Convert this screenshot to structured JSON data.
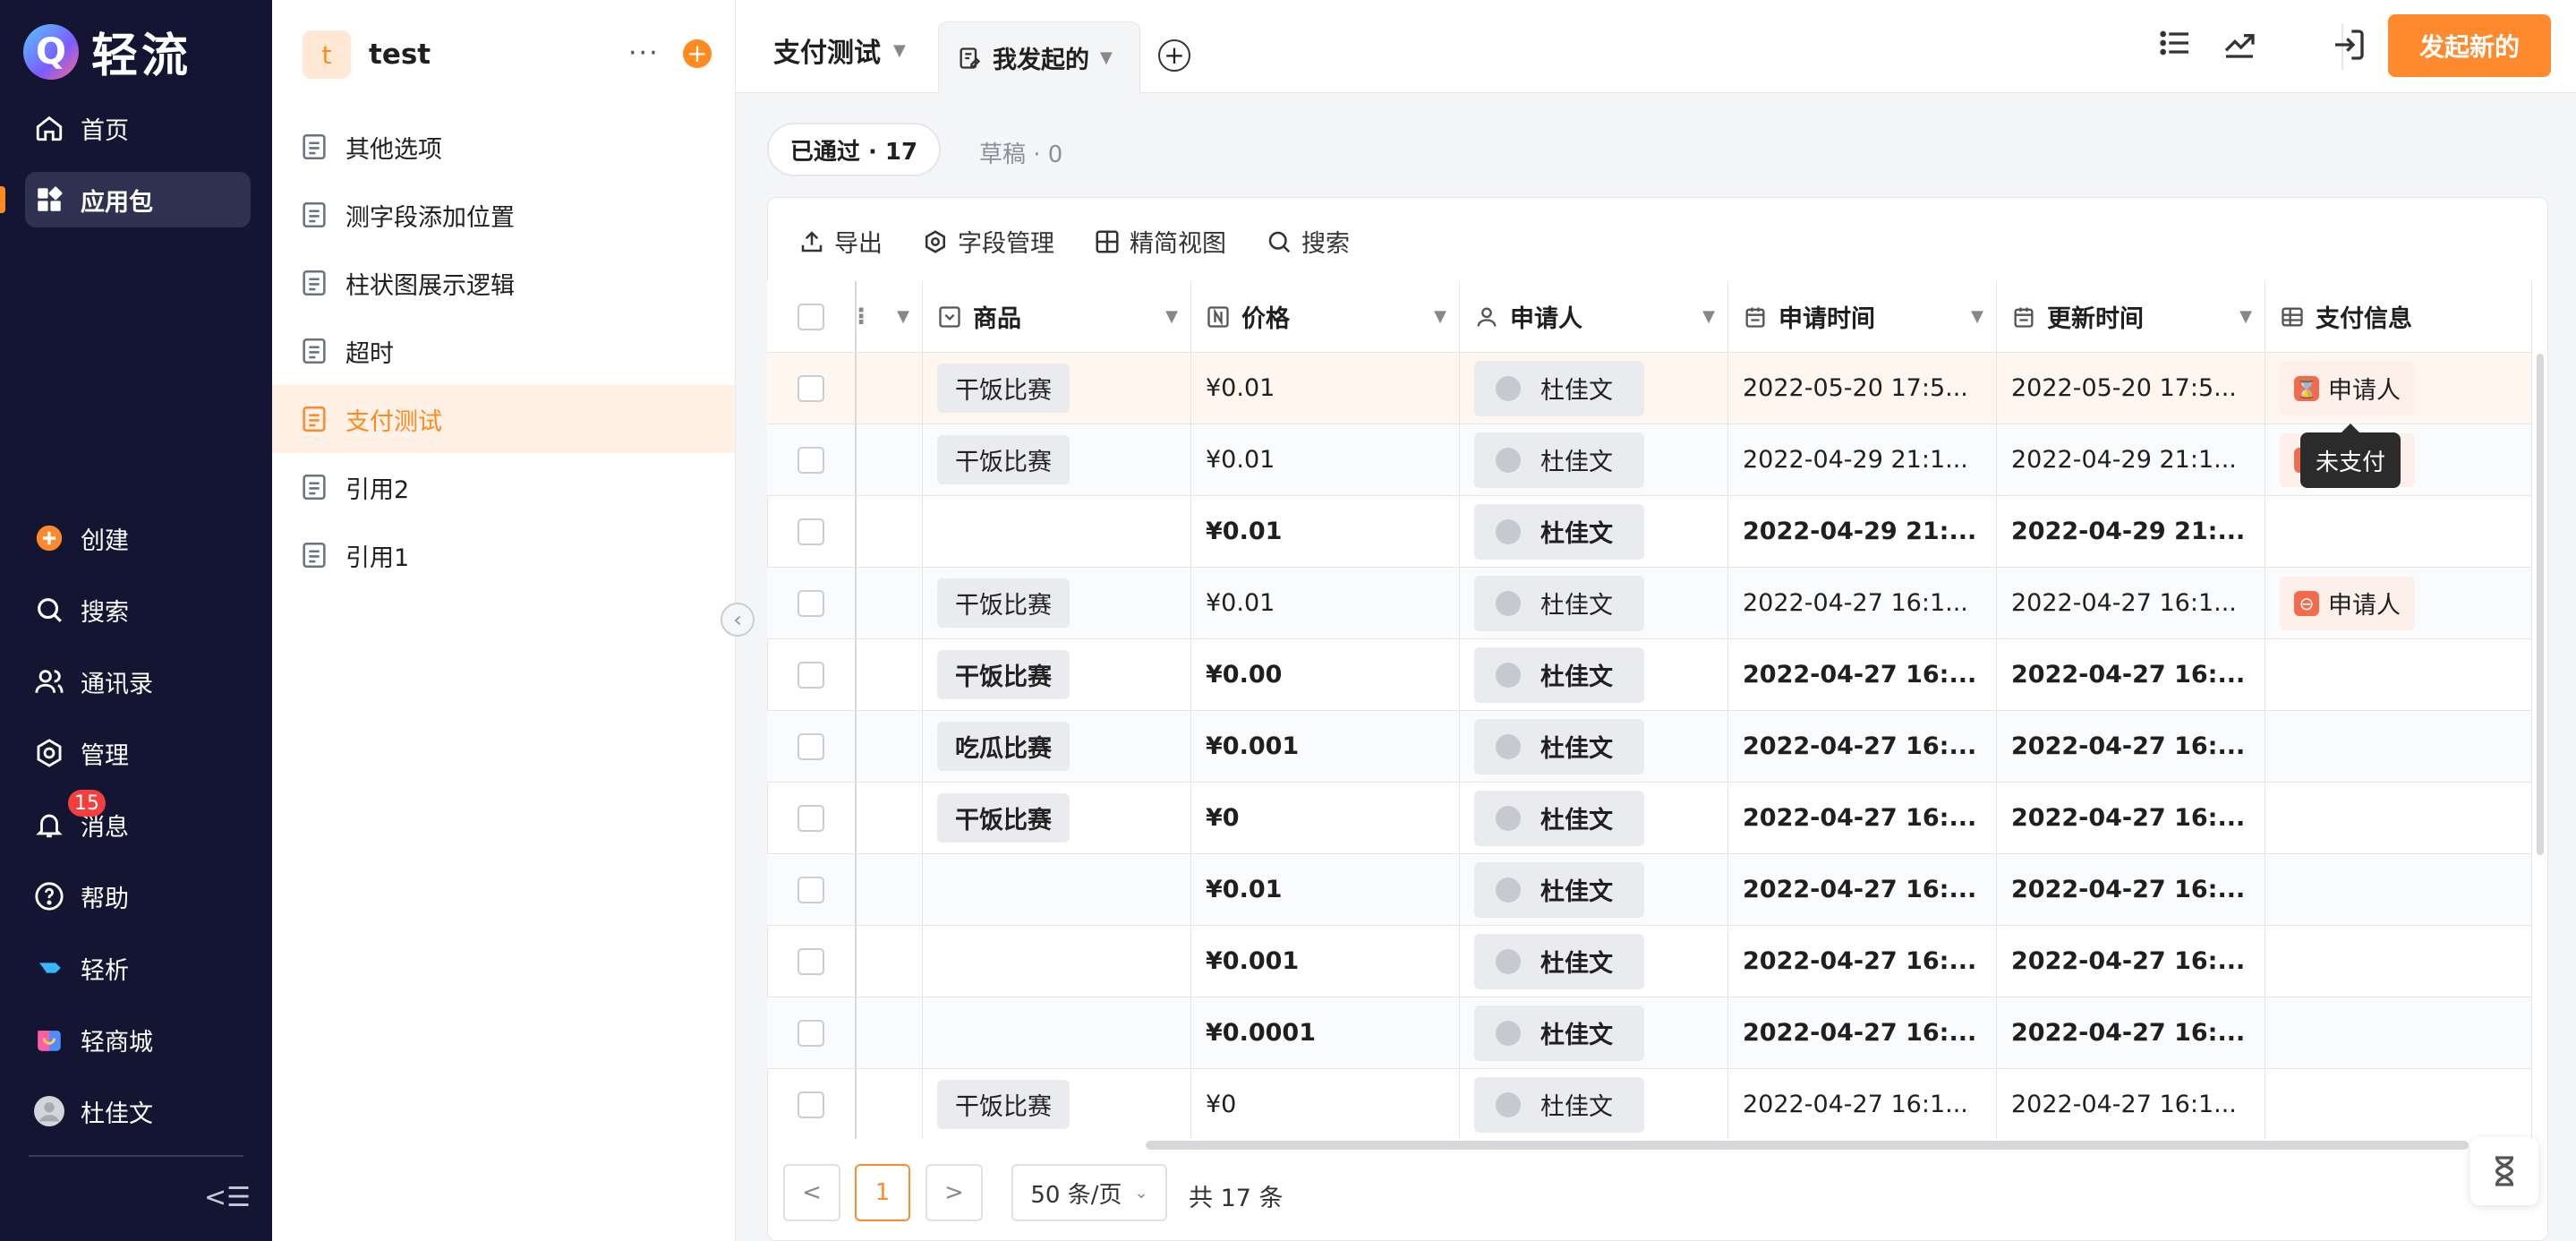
{
  "brand": {
    "mark": "Q",
    "name": "轻流"
  },
  "nav": {
    "top_items": [
      {
        "icon": "home-icon",
        "label": "首页"
      },
      {
        "icon": "apps-icon",
        "label": "应用包"
      }
    ],
    "bottom_items": [
      {
        "icon": "create-icon",
        "label": "创建"
      },
      {
        "icon": "search-icon",
        "label": "搜索"
      },
      {
        "icon": "contacts-icon",
        "label": "通讯录"
      },
      {
        "icon": "settings-icon",
        "label": "管理"
      },
      {
        "icon": "bell-icon",
        "label": "消息"
      },
      {
        "icon": "help-icon",
        "label": "帮助"
      },
      {
        "icon": "qingxi-icon",
        "label": "轻析"
      },
      {
        "icon": "shop-icon",
        "label": "轻商城"
      },
      {
        "icon": "avatar",
        "label": "杜佳文"
      }
    ],
    "message_badge": "15",
    "collapse_glyph": "<☰"
  },
  "sidebar": {
    "app_initial": "t",
    "app_name": "test",
    "more_glyph": "···",
    "add_glyph": "+",
    "forms": [
      "其他选项",
      "测字段添加位置",
      "柱状图展示逻辑",
      "超时",
      "支付测试",
      "引用2",
      "引用1"
    ],
    "active_form": "支付测试"
  },
  "topbar": {
    "form_title": "支付测试",
    "view_tab": "我发起的",
    "new_button": "发起新的"
  },
  "filters": {
    "approved": "已通过 · 17",
    "draft": "草稿 · 0"
  },
  "toolbar": {
    "export": "导出",
    "fields": "字段管理",
    "compact": "精简视图",
    "search": "搜索"
  },
  "table": {
    "columns": [
      "商品",
      "价格",
      "申请人",
      "申请时间",
      "更新时间",
      "支付信息"
    ],
    "rows": [
      {
        "product": "干饭比赛",
        "price": "¥0.01",
        "applicant": "杜佳文",
        "apply_time": "2022-05-20 17:5...",
        "update_time": "2022-05-20 17:5...",
        "pay": "申请人",
        "bold": false
      },
      {
        "product": "干饭比赛",
        "price": "¥0.01",
        "applicant": "杜佳文",
        "apply_time": "2022-04-29 21:1...",
        "update_time": "2022-04-29 21:1...",
        "pay": "申请人",
        "bold": false
      },
      {
        "product": "",
        "price": "¥0.01",
        "applicant": "杜佳文",
        "apply_time": "2022-04-29 21:...",
        "update_time": "2022-04-29 21:...",
        "pay": "",
        "bold": true
      },
      {
        "product": "干饭比赛",
        "price": "¥0.01",
        "applicant": "杜佳文",
        "apply_time": "2022-04-27 16:1...",
        "update_time": "2022-04-27 16:1...",
        "pay": "申请人",
        "bold": false
      },
      {
        "product": "干饭比赛",
        "price": "¥0.00",
        "applicant": "杜佳文",
        "apply_time": "2022-04-27 16:...",
        "update_time": "2022-04-27 16:...",
        "pay": "",
        "bold": true
      },
      {
        "product": "吃瓜比赛",
        "price": "¥0.001",
        "applicant": "杜佳文",
        "apply_time": "2022-04-27 16:...",
        "update_time": "2022-04-27 16:...",
        "pay": "",
        "bold": true
      },
      {
        "product": "干饭比赛",
        "price": "¥0",
        "applicant": "杜佳文",
        "apply_time": "2022-04-27 16:...",
        "update_time": "2022-04-27 16:...",
        "pay": "",
        "bold": true
      },
      {
        "product": "",
        "price": "¥0.01",
        "applicant": "杜佳文",
        "apply_time": "2022-04-27 16:...",
        "update_time": "2022-04-27 16:...",
        "pay": "",
        "bold": true
      },
      {
        "product": "",
        "price": "¥0.001",
        "applicant": "杜佳文",
        "apply_time": "2022-04-27 16:...",
        "update_time": "2022-04-27 16:...",
        "pay": "",
        "bold": true
      },
      {
        "product": "",
        "price": "¥0.0001",
        "applicant": "杜佳文",
        "apply_time": "2022-04-27 16:...",
        "update_time": "2022-04-27 16:...",
        "pay": "",
        "bold": true
      },
      {
        "product": "干饭比赛",
        "price": "¥0",
        "applicant": "杜佳文",
        "apply_time": "2022-04-27 16:1...",
        "update_time": "2022-04-27 16:1...",
        "pay": "",
        "bold": false
      }
    ],
    "tooltip": "未支付"
  },
  "pagination": {
    "prev": "<",
    "page": "1",
    "next": ">",
    "page_size": "50 条/页",
    "total": "共 17 条"
  },
  "colors": {
    "accent": "#ff8a2d",
    "nav_bg": "#141533",
    "active_bg": "#fff1e6"
  }
}
